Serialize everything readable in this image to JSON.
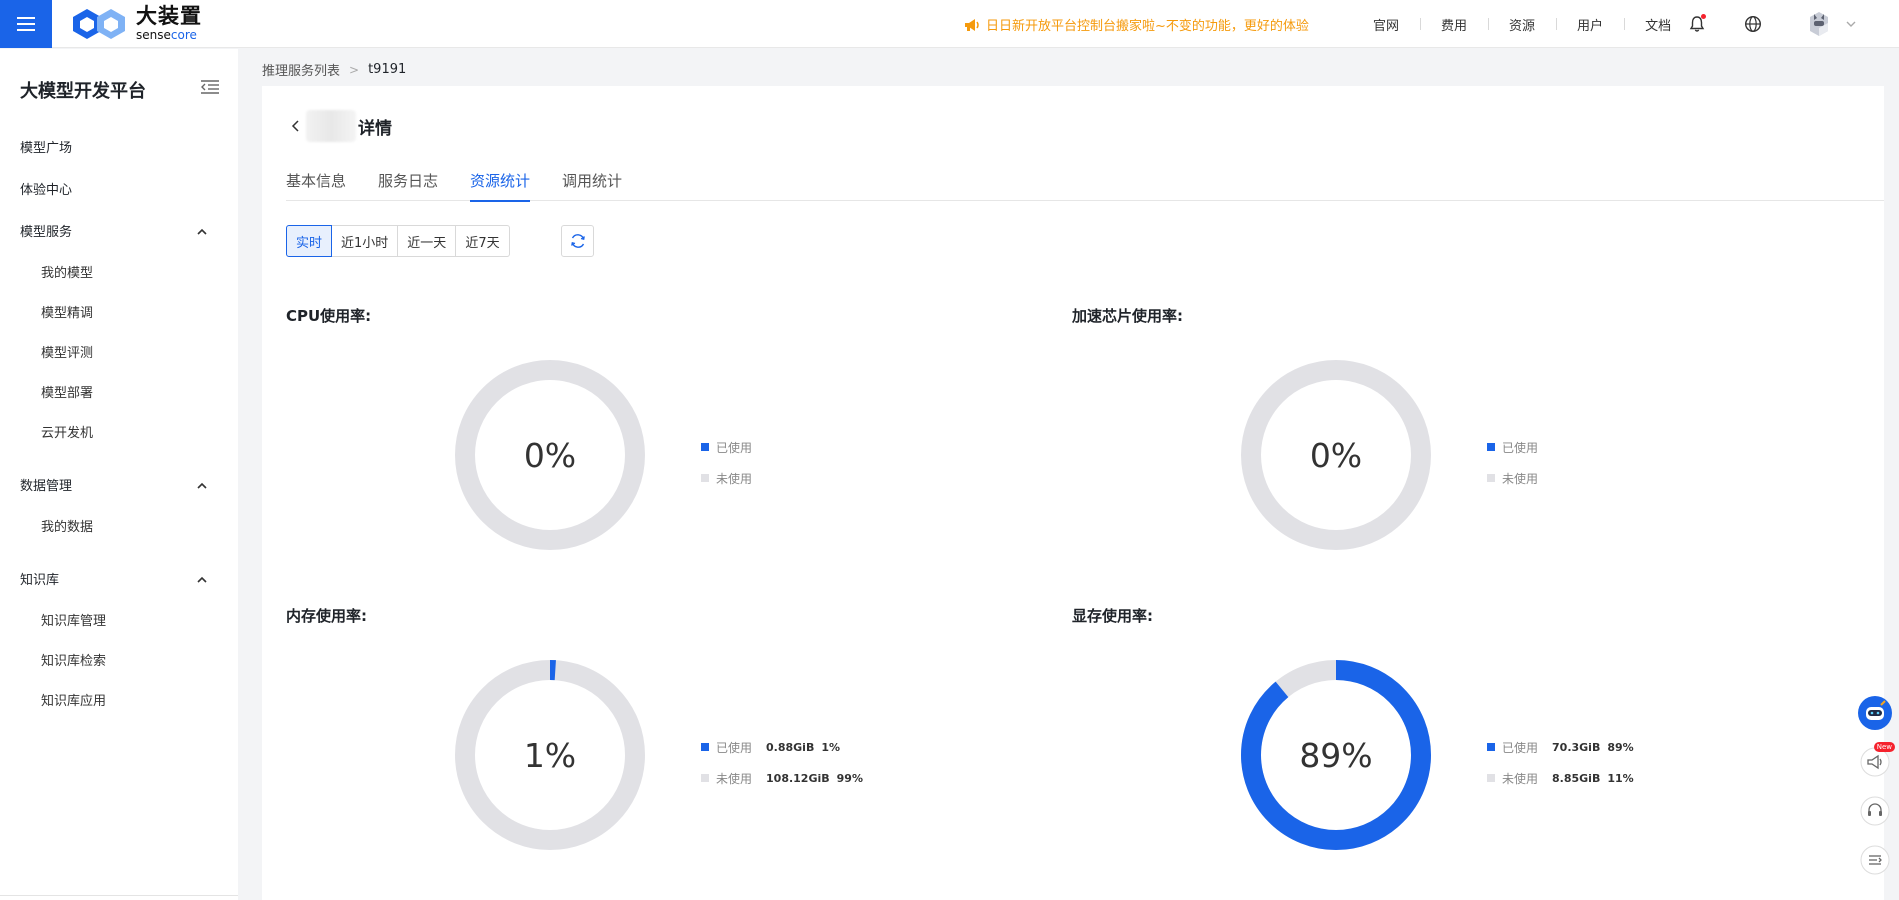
{
  "topbar": {
    "logo_cn": "大装置",
    "logo_en_a": "sense",
    "logo_en_b": "core",
    "notice": "日日新开放平台控制台搬家啦~不变的功能，更好的体验",
    "nav": [
      "官网",
      "费用",
      "资源",
      "用户",
      "文档"
    ],
    "icons": [
      "menu-icon",
      "bell-icon",
      "globe-icon",
      "avatar",
      "chevron-down-icon"
    ]
  },
  "sidebar": {
    "title": "大模型开发平台",
    "items": {
      "model_square": "模型广场",
      "experience": "体验中心",
      "model_service": "模型服务",
      "my_models": "我的模型",
      "finetune": "模型精调",
      "evaluate": "模型评测",
      "deploy": "模型部署",
      "cloud_dev": "云开发机",
      "data_mgmt": "数据管理",
      "my_data": "我的数据",
      "kb": "知识库",
      "kb_mgmt": "知识库管理",
      "kb_search": "知识库检索",
      "kb_app": "知识库应用"
    }
  },
  "breadcrumb": {
    "parent": "推理服务列表",
    "current": "t9191"
  },
  "page": {
    "title": "详情",
    "tabs": [
      "基本信息",
      "服务日志",
      "资源统计",
      "调用统计"
    ],
    "active_tab": "资源统计",
    "ranges": [
      "实时",
      "近1小时",
      "近一天",
      "近7天"
    ],
    "active_range": "实时"
  },
  "colors": {
    "accent": "#1a64e8",
    "unused": "#e1e1e5",
    "notice": "#f59a0c"
  },
  "metrics": {
    "cpu": {
      "title": "CPU使用率:",
      "percent_label": "0%",
      "used_fraction": 0.0,
      "legend_used": "已使用",
      "legend_unused": "未使用"
    },
    "accel": {
      "title": "加速芯片使用率:",
      "percent_label": "0%",
      "used_fraction": 0.0,
      "legend_used": "已使用",
      "legend_unused": "未使用"
    },
    "memory": {
      "title": "内存使用率:",
      "percent_label": "1%",
      "used_fraction": 0.01,
      "legend_used": "已使用",
      "used_value": "0.88GiB",
      "used_pct": "1%",
      "legend_unused": "未使用",
      "unused_value": "108.12GiB",
      "unused_pct": "99%"
    },
    "vram": {
      "title": "显存使用率:",
      "percent_label": "89%",
      "used_fraction": 0.89,
      "legend_used": "已使用",
      "used_value": "70.3GiB",
      "used_pct": "89%",
      "legend_unused": "未使用",
      "unused_value": "8.85GiB",
      "unused_pct": "11%"
    }
  },
  "float": {
    "new_badge": "New"
  }
}
